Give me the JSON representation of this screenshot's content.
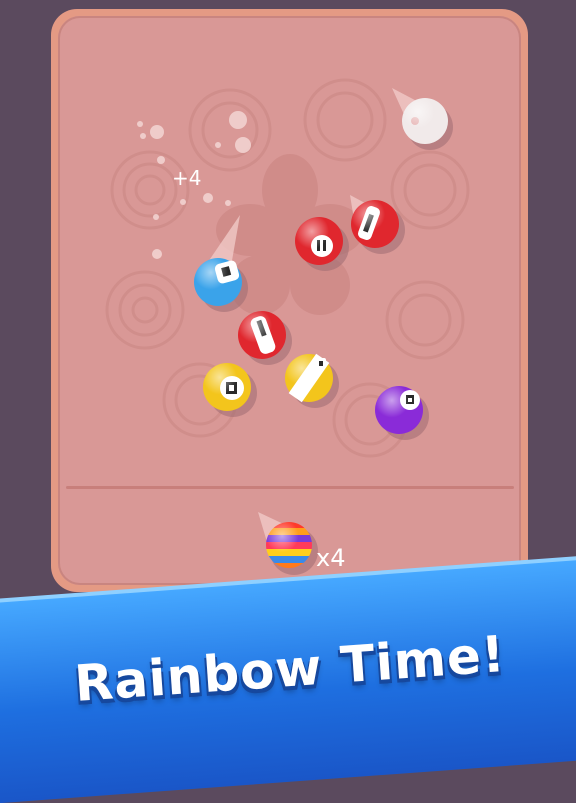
{
  "game": {
    "score_popup": "+4",
    "multiplier_label": "x4",
    "banner_text": "Rainbow Time!"
  },
  "balls": [
    {
      "id": "cue",
      "color": "#f1eaea",
      "stripe": false,
      "number": ""
    },
    {
      "id": "red-2",
      "color": "#e0272e",
      "stripe": false,
      "number": "11"
    },
    {
      "id": "red-1",
      "color": "#e0272e",
      "stripe": false,
      "number": "1"
    },
    {
      "id": "blue",
      "color": "#3aa3ea",
      "stripe": false,
      "number": "10"
    },
    {
      "id": "red-3",
      "color": "#e0272e",
      "stripe": false,
      "number": "11"
    },
    {
      "id": "yellow-1",
      "color": "#f3c51c",
      "stripe": false,
      "number": "9"
    },
    {
      "id": "yellow-2",
      "color": "#f3c51c",
      "stripe": true,
      "number": "1"
    },
    {
      "id": "purple",
      "color": "#8a2bd8",
      "stripe": false,
      "number": "4"
    },
    {
      "id": "rainbow",
      "color": "#ff5a2a",
      "stripe": true,
      "number": ""
    }
  ],
  "colors": {
    "background": "#5b4a5e",
    "board_border": "#e49a84",
    "board_fill": "#d99896",
    "banner_blue": "#1e6fe0"
  }
}
